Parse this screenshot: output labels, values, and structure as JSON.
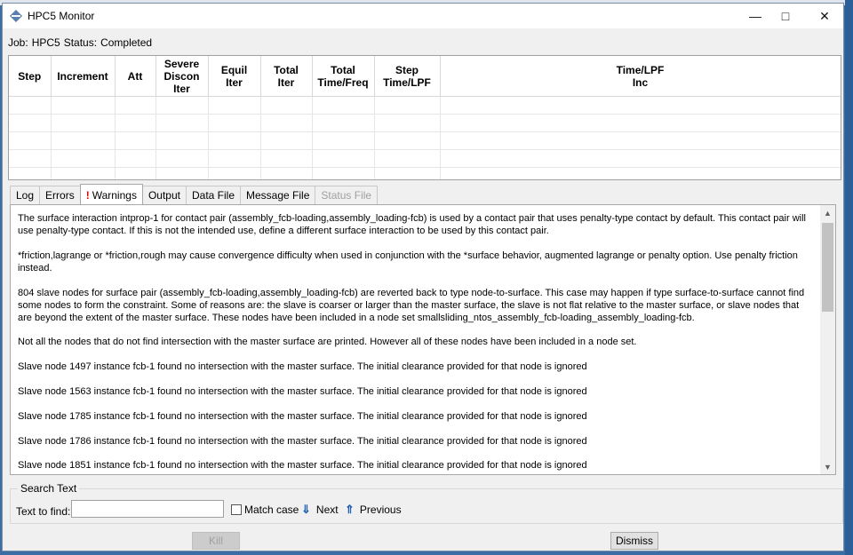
{
  "window": {
    "title": "HPC5 Monitor"
  },
  "job": {
    "label": "Job:",
    "name": "HPC5",
    "status_label": "Status:",
    "status": "Completed"
  },
  "grid": {
    "columns": [
      {
        "label": "Step"
      },
      {
        "label": "Increment"
      },
      {
        "label": "Att"
      },
      {
        "label": "Severe\nDiscon\nIter"
      },
      {
        "label": "Equil\nIter"
      },
      {
        "label": "Total\nIter"
      },
      {
        "label": "Total\nTime/Freq"
      },
      {
        "label": "Step\nTime/LPF"
      },
      {
        "label": "Time/LPF\nInc"
      }
    ]
  },
  "tabs": [
    {
      "label": "Log"
    },
    {
      "label": "Errors"
    },
    {
      "label": "Warnings",
      "mark": "!"
    },
    {
      "label": "Output"
    },
    {
      "label": "Data File"
    },
    {
      "label": "Message File"
    },
    {
      "label": "Status File"
    }
  ],
  "log": {
    "paragraphs": [
      "The surface interaction intprop-1 for contact pair (assembly_fcb-loading,assembly_loading-fcb) is used by a contact pair that uses penalty-type contact by default. This contact pair will use penalty-type contact. If this is not the intended use, define a different surface interaction to be used by this contact pair.",
      "*friction,lagrange or *friction,rough may cause convergence difficulty when used in conjunction with the *surface behavior, augmented lagrange or penalty option. Use penalty friction instead.",
      "804 slave nodes for surface pair (assembly_fcb-loading,assembly_loading-fcb) are reverted back to type node-to-surface. This case may happen if type surface-to-surface cannot find some nodes to form the constraint. Some of reasons are: the slave is coarser or larger than the master surface, the slave is not flat relative to the master surface, or slave nodes that are beyond the extent of the master surface. These nodes have been included in a node set smallsliding_ntos_assembly_fcb-loading_assembly_loading-fcb.",
      "Not all the nodes that do not find intersection with the master surface are printed. However all of these nodes have been included in a node set.",
      "Slave node 1497 instance fcb-1 found no intersection with the master surface. The initial clearance provided for that node is ignored",
      "Slave node 1563 instance fcb-1 found no intersection with the master surface. The initial clearance provided for that node is ignored",
      "Slave node 1785 instance fcb-1 found no intersection with the master surface. The initial clearance provided for that node is ignored",
      "Slave node 1786 instance fcb-1 found no intersection with the master surface. The initial clearance provided for that node is ignored",
      "Slave node 1851 instance fcb-1 found no intersection with the master surface. The initial clearance provided for that node is ignored"
    ]
  },
  "search": {
    "group_title": "Search Text",
    "find_label": "Text to find:",
    "find_value": "",
    "match_case_label": "Match case",
    "next_label": "Next",
    "previous_label": "Previous"
  },
  "buttons": {
    "kill_label": "Kill",
    "dismiss_label": "Dismiss"
  }
}
